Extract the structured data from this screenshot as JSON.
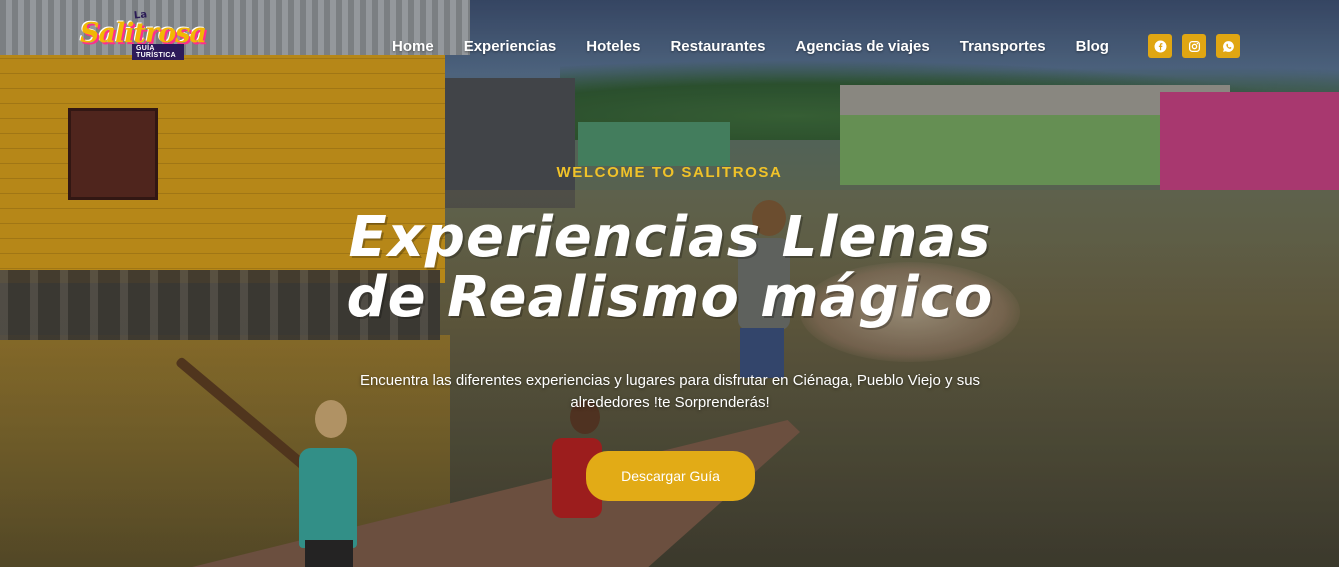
{
  "brand": {
    "logo_top": "La",
    "logo_main": "Salitrosa",
    "logo_sub": "GUÍA TURÍSTICA"
  },
  "nav": {
    "items": [
      {
        "label": "Home"
      },
      {
        "label": "Experiencias"
      },
      {
        "label": "Hoteles"
      },
      {
        "label": "Restaurantes"
      },
      {
        "label": "Agencias de viajes"
      },
      {
        "label": "Transportes"
      },
      {
        "label": "Blog"
      }
    ]
  },
  "social": [
    {
      "icon": "facebook-icon"
    },
    {
      "icon": "instagram-icon"
    },
    {
      "icon": "whatsapp-icon"
    }
  ],
  "hero": {
    "eyebrow": "WELCOME TO SALITROSA",
    "headline_line1": "Experiencias Llenas",
    "headline_line2": "de Realismo mágico",
    "subtext_line1": "Encuentra las diferentes experiencias y  lugares para disfrutar en Ciénaga, Pueblo Viejo y sus",
    "subtext_line2": "alrededores  !te Sorprenderás!",
    "cta_label": "Descargar Guía"
  },
  "colors": {
    "accent": "#e2ab16",
    "eyebrow": "#f0c229",
    "text": "#ffffff"
  }
}
